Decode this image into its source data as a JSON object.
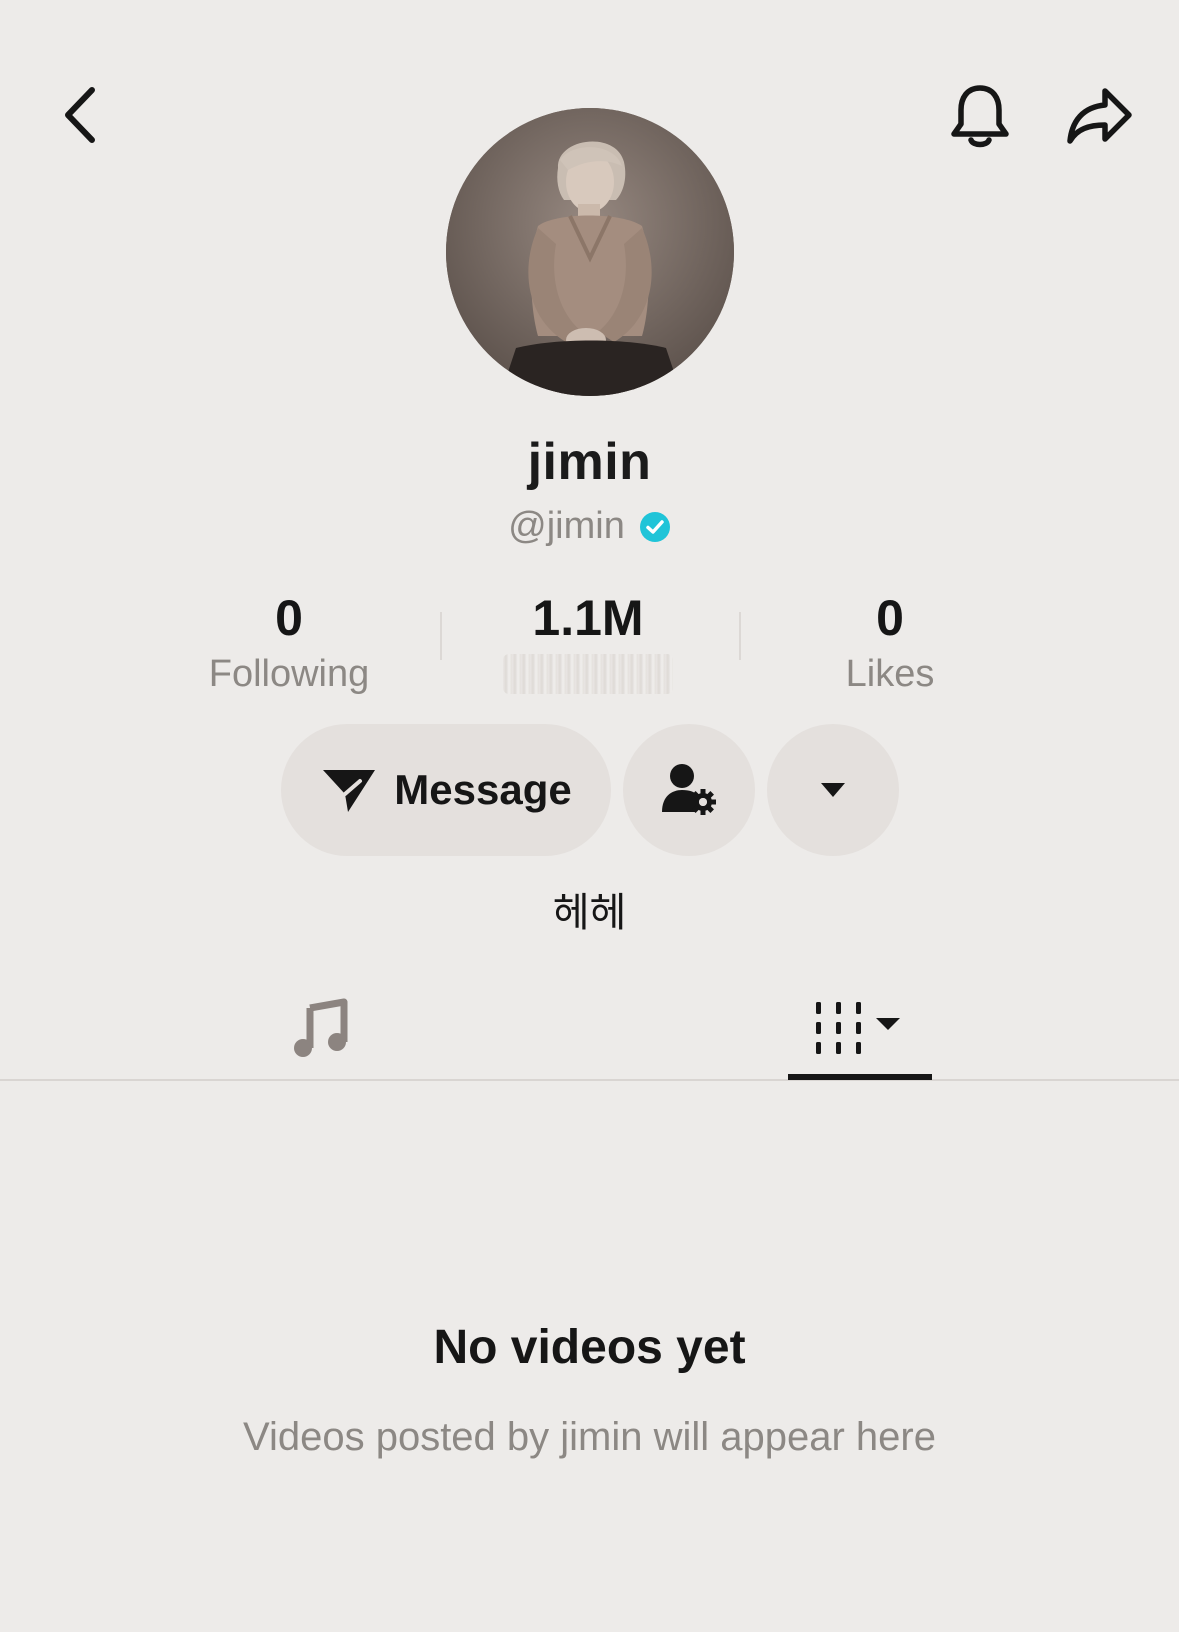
{
  "header": {
    "back_icon": "chevron-left-icon",
    "bell_icon": "bell-icon",
    "share_icon": "share-arrow-icon"
  },
  "profile": {
    "display_name": "jimin",
    "handle": "@jimin",
    "verified": true,
    "verified_color": "#20c4d8",
    "bio": "헤헤"
  },
  "stats": {
    "following": {
      "value": "0",
      "label": "Following"
    },
    "followers": {
      "value": "1.1M"
    },
    "likes": {
      "value": "0",
      "label": "Likes"
    }
  },
  "actions": {
    "message_label": "Message",
    "message_icon": "send-icon",
    "friends_icon": "user-settings-icon",
    "more_icon": "caret-down-icon"
  },
  "tabs": [
    {
      "id": "music",
      "icon": "music-note-icon",
      "active": false
    },
    {
      "id": "videos",
      "icon": "video-grid-icon",
      "active": true
    }
  ],
  "empty_state": {
    "title": "No videos yet",
    "subtitle": "Videos posted by jimin will appear here"
  },
  "colors": {
    "background": "#edebe9",
    "button_bg": "#e4e0dd",
    "text_primary": "#161616",
    "text_secondary": "#8c8884"
  }
}
